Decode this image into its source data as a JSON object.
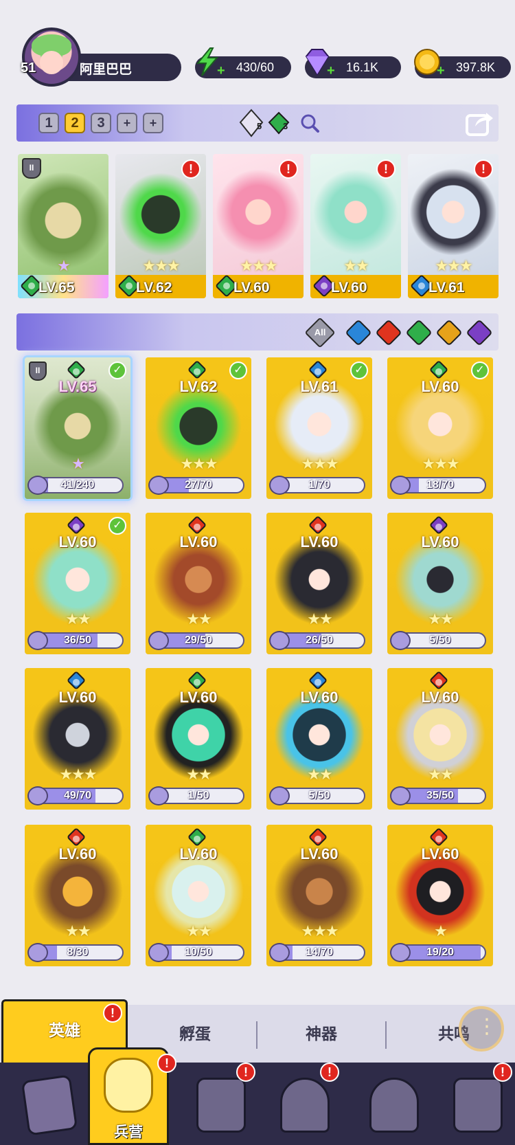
{
  "player": {
    "level": "51",
    "name": "阿里巴巴"
  },
  "resources": {
    "energy": "430/60",
    "gems": "16.1K",
    "gold": "397.8K"
  },
  "team": {
    "tabs": [
      "1",
      "2",
      "3",
      "+",
      "+"
    ],
    "active_tab": "2",
    "crystal_counts": [
      "5",
      "3"
    ],
    "heroes": [
      {
        "level": "LV.65",
        "element": "nature",
        "alert": false,
        "rank": "II",
        "stars": "★"
      },
      {
        "level": "LV.62",
        "element": "nature",
        "alert": true,
        "stars": "★★★"
      },
      {
        "level": "LV.60",
        "element": "nature",
        "alert": true,
        "stars": "★★★"
      },
      {
        "level": "LV.60",
        "element": "dark",
        "alert": true,
        "stars": "★★"
      },
      {
        "level": "LV.61",
        "element": "water",
        "alert": true,
        "stars": "★★★"
      }
    ]
  },
  "filters": {
    "all_label": "All",
    "elements": [
      "water",
      "fire",
      "nature",
      "light",
      "dark"
    ]
  },
  "element_colors": {
    "nature": "#2fae4a",
    "water": "#2a86d8",
    "fire": "#e0341f",
    "dark": "#7b3fc4",
    "light": "#e6a21a"
  },
  "heroes": [
    {
      "level": "LV.65",
      "element": "nature",
      "progress": "41/240",
      "fill": 0.17,
      "checked": true,
      "selected": true,
      "rank": "II",
      "stars": "★"
    },
    {
      "level": "LV.62",
      "element": "nature",
      "progress": "27/70",
      "fill": 0.39,
      "checked": true,
      "stars": "★★★"
    },
    {
      "level": "LV.61",
      "element": "water",
      "progress": "1/70",
      "fill": 0.01,
      "checked": true,
      "stars": "★★★"
    },
    {
      "level": "LV.60",
      "element": "nature",
      "progress": "18/70",
      "fill": 0.26,
      "checked": true,
      "stars": "★★★"
    },
    {
      "level": "LV.60",
      "element": "dark",
      "progress": "36/50",
      "fill": 0.72,
      "checked": true,
      "stars": "★★"
    },
    {
      "level": "LV.60",
      "element": "fire",
      "progress": "29/50",
      "fill": 0.58,
      "stars": "★★"
    },
    {
      "level": "LV.60",
      "element": "fire",
      "progress": "26/50",
      "fill": 0.52,
      "stars": "★★"
    },
    {
      "level": "LV.60",
      "element": "dark",
      "progress": "5/50",
      "fill": 0.1,
      "stars": "★★"
    },
    {
      "level": "LV.60",
      "element": "water",
      "progress": "49/70",
      "fill": 0.7,
      "stars": "★★★"
    },
    {
      "level": "LV.60",
      "element": "nature",
      "progress": "1/50",
      "fill": 0.02,
      "stars": "★★"
    },
    {
      "level": "LV.60",
      "element": "water",
      "progress": "5/50",
      "fill": 0.1,
      "stars": "★★"
    },
    {
      "level": "LV.60",
      "element": "fire",
      "progress": "35/50",
      "fill": 0.7,
      "stars": "★★"
    },
    {
      "level": "LV.60",
      "element": "fire",
      "progress": "8/30",
      "fill": 0.27,
      "stars": "★★"
    },
    {
      "level": "LV.60",
      "element": "nature",
      "progress": "10/50",
      "fill": 0.2,
      "stars": "★★"
    },
    {
      "level": "LV.60",
      "element": "fire",
      "progress": "14/70",
      "fill": 0.2,
      "stars": "★★★"
    },
    {
      "level": "LV.60",
      "element": "fire",
      "progress": "19/20",
      "fill": 0.95,
      "stars": "★"
    }
  ],
  "tabs": {
    "heroes": "英雄",
    "hatch": "孵蛋",
    "artifact": "神器",
    "resonance": "共鸣"
  },
  "nav": {
    "barracks": "兵营"
  }
}
